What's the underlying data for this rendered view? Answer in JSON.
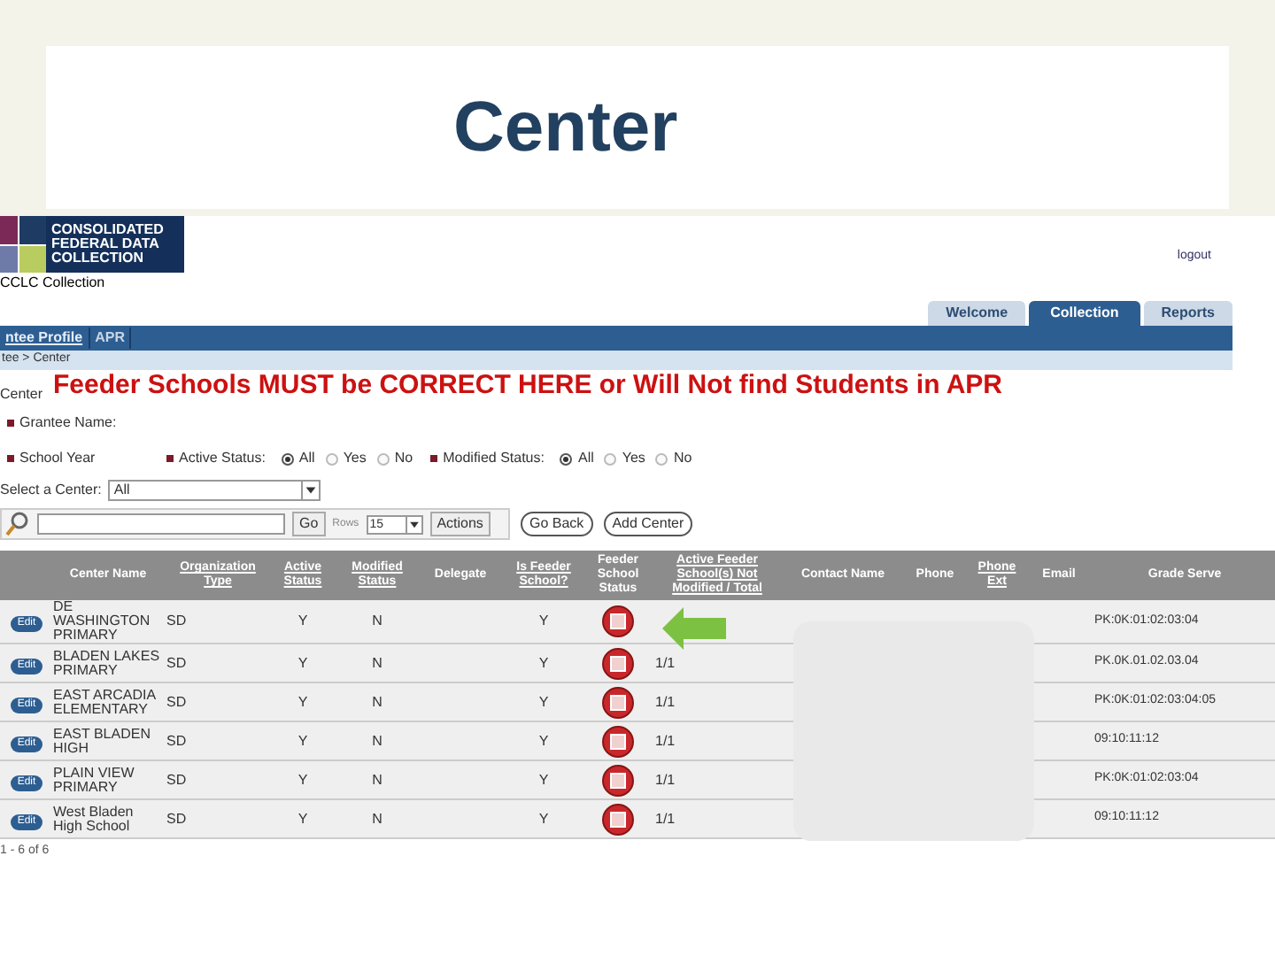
{
  "slide_title": "Center",
  "header": {
    "logo_text": "CONSOLIDATED FEDERAL DATA COLLECTION",
    "collection": "CCLC Collection",
    "logout": "logout"
  },
  "tabs": [
    {
      "label": "Welcome",
      "selected": false
    },
    {
      "label": "Collection",
      "selected": true
    },
    {
      "label": "Reports",
      "selected": false
    }
  ],
  "nav": [
    {
      "label": "ntee Profile",
      "selected": true
    },
    {
      "label": "APR",
      "selected": false
    }
  ],
  "breadcrumb": "tee > Center",
  "page_label": "Center",
  "banner": "Feeder Schools MUST be CORRECT HERE or Will Not find Students in APR",
  "filters": {
    "grantee_label": "Grantee Name:",
    "school_year_label": "School Year",
    "radio_groups": [
      {
        "label": "Active Status:",
        "options": [
          {
            "label": "All",
            "selected": true
          },
          {
            "label": "Yes",
            "selected": false
          },
          {
            "label": "No",
            "selected": false
          }
        ]
      },
      {
        "label": "Modified Status:",
        "options": [
          {
            "label": "All",
            "selected": true
          },
          {
            "label": "Yes",
            "selected": false
          },
          {
            "label": "No",
            "selected": false
          }
        ]
      }
    ],
    "center_label": "Select a Center:",
    "center_value": "All"
  },
  "toolbar": {
    "go": "Go",
    "rows_label": "Rows",
    "rows_value": "15",
    "actions": "Actions",
    "go_back": "Go Back",
    "add_center": "Add Center"
  },
  "table": {
    "columns": [
      "",
      "Center Name",
      "Organization Type",
      "Active Status",
      "Modified Status",
      "Delegate",
      "Is Feeder School?",
      "Feeder School Status",
      "Active Feeder School(s) Not Modified / Total",
      "Contact Name",
      "Phone",
      "Phone Ext",
      "Email",
      "Grade Serve"
    ],
    "edit_labels": [
      "Edit",
      "Edit",
      "Edit",
      "Edit",
      "Edit",
      "Edit"
    ],
    "rows": [
      {
        "name": "DE WASHINGTON PRIMARY",
        "org": "SD",
        "active": "Y",
        "modified": "N",
        "feeder": "Y",
        "ratio": "",
        "grades": "PK:0K:01:02:03:04"
      },
      {
        "name": "BLADEN LAKES PRIMARY",
        "org": "SD",
        "active": "Y",
        "modified": "N",
        "feeder": "Y",
        "ratio": "1/1",
        "grades": "PK.0K.01.02.03.04"
      },
      {
        "name": "EAST ARCADIA ELEMENTARY",
        "org": "SD",
        "active": "Y",
        "modified": "N",
        "feeder": "Y",
        "ratio": "1/1",
        "grades": "PK:0K:01:02:03:04:05"
      },
      {
        "name": "EAST BLADEN HIGH",
        "org": "SD",
        "active": "Y",
        "modified": "N",
        "feeder": "Y",
        "ratio": "1/1",
        "grades": "09:10:11:12"
      },
      {
        "name": "PLAIN VIEW PRIMARY",
        "org": "SD",
        "active": "Y",
        "modified": "N",
        "feeder": "Y",
        "ratio": "1/1",
        "grades": "PK:0K:01:02:03:04"
      },
      {
        "name": "West Bladen High School",
        "org": "SD",
        "active": "Y",
        "modified": "N",
        "feeder": "Y",
        "ratio": "1/1",
        "grades": "09:10:11:12"
      }
    ],
    "footer": "1 - 6 of 6"
  }
}
